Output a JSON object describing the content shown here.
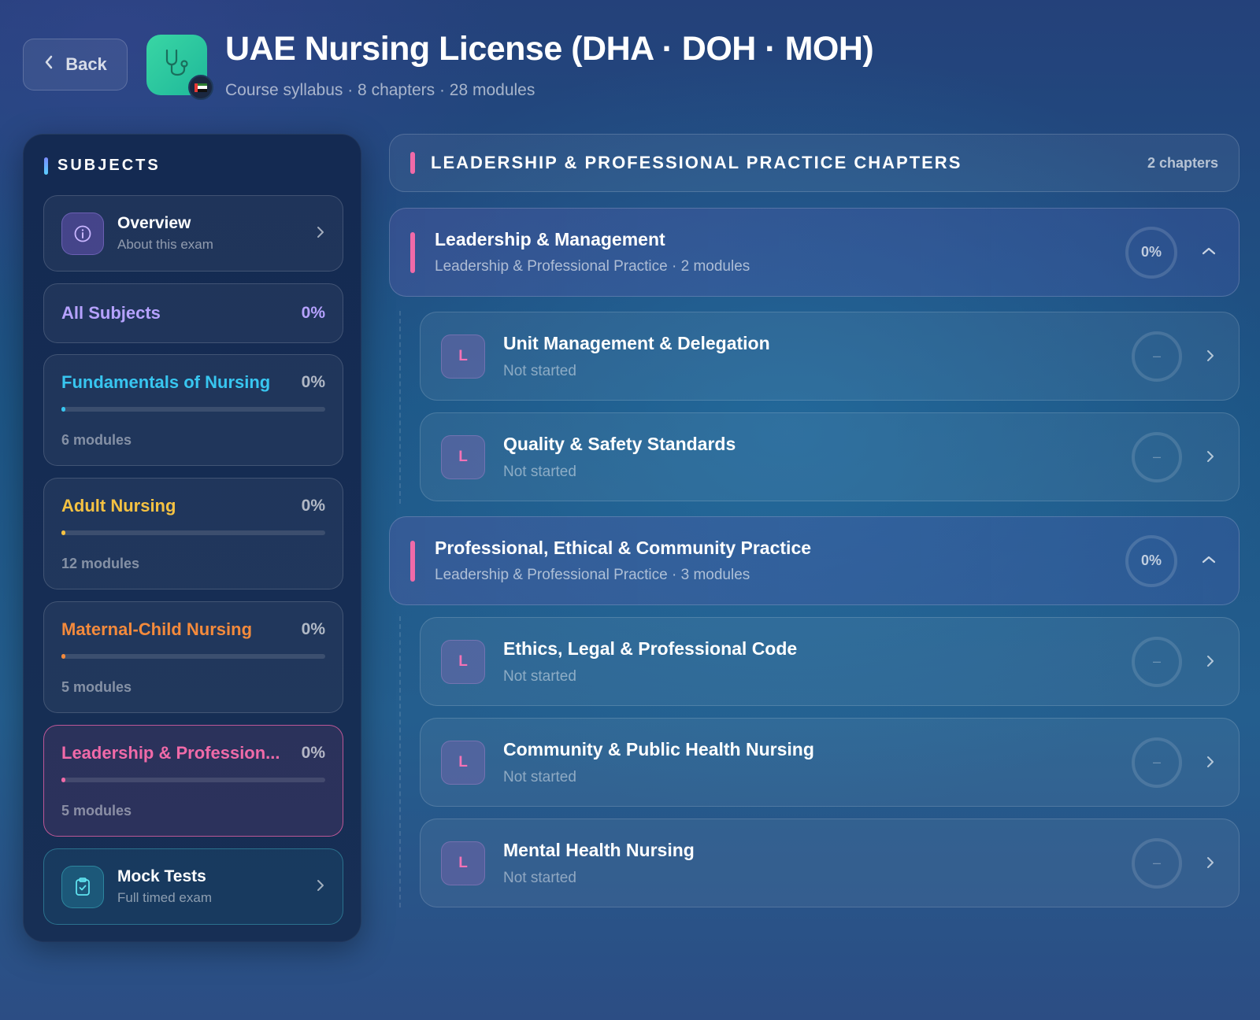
{
  "header": {
    "back_label": "Back",
    "title": "UAE Nursing License (DHA · DOH · MOH)",
    "subtitle": "Course syllabus · 8 chapters · 28 modules"
  },
  "sidebar": {
    "heading": "SUBJECTS",
    "overview": {
      "title": "Overview",
      "subtitle": "About this exam"
    },
    "all_subjects": {
      "label": "All Subjects",
      "percent": "0%"
    },
    "subjects": [
      {
        "name": "Fundamentals of Nursing",
        "percent": "0%",
        "modules": "6 modules",
        "color": "#38c6f0",
        "progress": 0
      },
      {
        "name": "Adult Nursing",
        "percent": "0%",
        "modules": "12 modules",
        "color": "#f5c242",
        "progress": 0
      },
      {
        "name": "Maternal-Child Nursing",
        "percent": "0%",
        "modules": "5 modules",
        "color": "#f48a3c",
        "progress": 0
      },
      {
        "name": "Leadership & Profession...",
        "percent": "0%",
        "modules": "5 modules",
        "color": "#f06aa8",
        "progress": 0,
        "active": true
      }
    ],
    "mock_tests": {
      "title": "Mock Tests",
      "subtitle": "Full timed exam"
    }
  },
  "main": {
    "section_title": "LEADERSHIP & PROFESSIONAL PRACTICE CHAPTERS",
    "section_count": "2 chapters",
    "chapters": [
      {
        "title": "Leadership & Management",
        "subtitle": "Leadership & Professional Practice · 2 modules",
        "percent": "0%",
        "modules": [
          {
            "badge": "L",
            "title": "Unit Management & Delegation",
            "status": "Not started",
            "ring": "–"
          },
          {
            "badge": "L",
            "title": "Quality & Safety Standards",
            "status": "Not started",
            "ring": "–"
          }
        ]
      },
      {
        "title": "Professional, Ethical & Community Practice",
        "subtitle": "Leadership & Professional Practice · 3 modules",
        "percent": "0%",
        "modules": [
          {
            "badge": "L",
            "title": "Ethics, Legal & Professional Code",
            "status": "Not started",
            "ring": "–"
          },
          {
            "badge": "L",
            "title": "Community & Public Health Nursing",
            "status": "Not started",
            "ring": "–"
          },
          {
            "badge": "L",
            "title": "Mental Health Nursing",
            "status": "Not started",
            "ring": "–"
          }
        ]
      }
    ]
  },
  "colors": {
    "accent_pink": "#f06aa8",
    "accent_purple": "#b6a2ff",
    "app_icon": "#2cc99f"
  },
  "icons": {
    "back": "chevron-left-icon",
    "app": "stethoscope-icon",
    "flag": "uae-flag-icon",
    "overview": "info-icon",
    "mock_tests": "clipboard-check-icon",
    "nav": "chevron-right-icon",
    "collapse": "chevron-up-icon"
  }
}
